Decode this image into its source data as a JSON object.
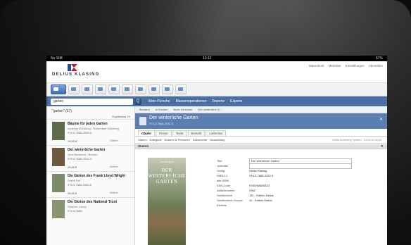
{
  "status": {
    "left": "No SIM",
    "time": "10:12",
    "right": "67%"
  },
  "header": {
    "logo_text": "DELIUS KLASING",
    "links": [
      "Warenkorb",
      "Merkliste",
      "Einstellungen",
      "Abmelden"
    ]
  },
  "search": {
    "value": "garten",
    "button": "Q"
  },
  "menu": [
    "Mein Porsche",
    "Massenoperationen",
    "Reports",
    "Exporte"
  ],
  "list": {
    "header": "\"garten\" (27)",
    "pager": "Ergebnisse",
    "page": "10",
    "items": [
      {
        "title": "Bäume für jeden Garten",
        "author": "Andreas Mühlberg / Rosemarie Mühlberg",
        "meta": "978-3-7688-2589-4",
        "price": "19,90 €",
        "status": "Online"
      },
      {
        "title": "Der winterliche Garten",
        "author": "Jens Barnbeck / Bertold",
        "meta": "978-3-7688-2532-3",
        "price": "29,90 €",
        "status": "Online"
      },
      {
        "title": "Die Gärten des Frank Lloyd Wright",
        "author": "Derek Fell",
        "meta": "978-3-7688-2083-0",
        "price": "39,90 €",
        "status": "Online"
      },
      {
        "title": "Die Gärten des National Trust",
        "author": "Stephen Lacey",
        "meta": "978-3-7688-",
        "price": "",
        "status": ""
      }
    ]
  },
  "detail": {
    "crumbs": [
      "Bestand",
      "in Suchen",
      "Buch Vorschau",
      "Der winterliche G..."
    ],
    "title": "Der winterliche Garten",
    "isbn": "978-3-7688-2532-3",
    "tabs": [
      "Objekt",
      "Preise",
      "Texte",
      "Bestellt",
      "Lieferstat"
    ],
    "subtabs": [
      "Stamm",
      "Kategorie",
      "Autoren & Personen",
      "Dokumente",
      "Ausstattung"
    ],
    "note": "Letzte Änderung: system - 01.09.11 00:42",
    "section": "Stamm",
    "cover_title": "DER WINTERLICHE GARTEN",
    "cover_author": "Jens Barnbeck",
    "fields": [
      {
        "k": "Titel",
        "v": "Der winterliche Garten",
        "boxed": true
      },
      {
        "k": "Untertitel",
        "v": "",
        "boxed": true
      },
      {
        "k": "Verlag",
        "v": "Delius Klasing"
      },
      {
        "k": "ISBN-13",
        "v": "978-3-7688-2532-3"
      },
      {
        "k": "alte ISBN",
        "v": ""
      },
      {
        "k": "EAN-Code",
        "v": "9783768825323"
      },
      {
        "k": "Artikelnummer",
        "v": "2962"
      },
      {
        "k": "Sachbereich",
        "v": "131 - Edition Delius"
      },
      {
        "k": "Sachbereich-Gruppe",
        "v": "10 - Edition Delius"
      },
      {
        "k": "Einheits",
        "v": ""
      }
    ]
  }
}
